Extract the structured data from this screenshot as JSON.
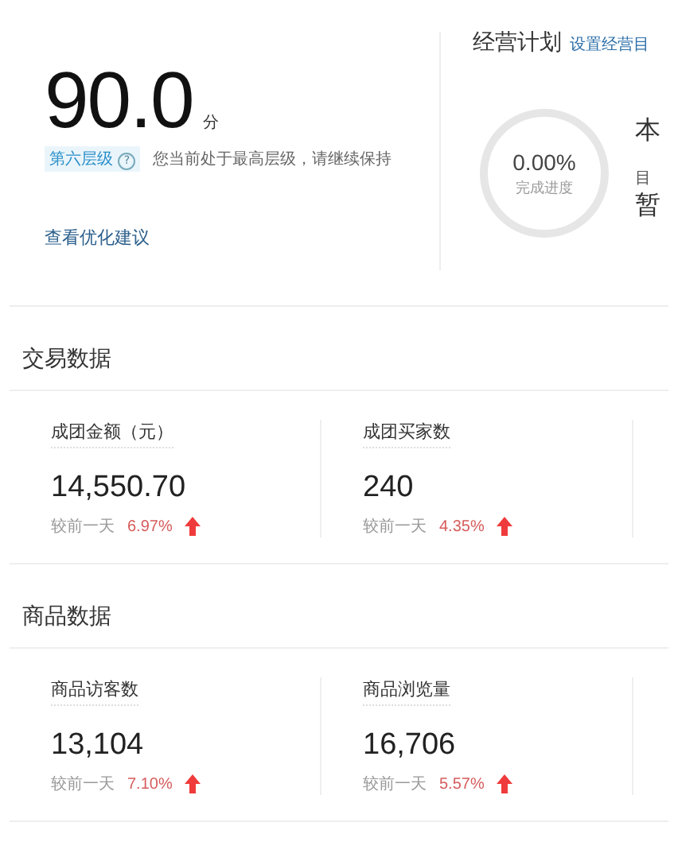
{
  "score": {
    "value": "90.0",
    "unit": "分",
    "level_tag": "第六层级",
    "level_help": "?",
    "message": "您当前处于最高层级，请继续保持",
    "link": "查看优化建议"
  },
  "plan": {
    "title": "经营计划",
    "link": "设置经营目",
    "progress_value": "0.00%",
    "progress_label": "完成进度",
    "month_label": "本",
    "target_label": "目",
    "target_value": "暂"
  },
  "sections": [
    {
      "title": "交易数据",
      "metrics": [
        {
          "label": "成团金额（元）",
          "value": "14,550.70",
          "compare": "较前一天",
          "change": "6.97%",
          "kind": "up"
        },
        {
          "label": "成团买家数",
          "value": "240",
          "compare": "较前一天",
          "change": "4.35%",
          "kind": "up"
        }
      ]
    },
    {
      "title": "商品数据",
      "metrics": [
        {
          "label": "商品访客数",
          "value": "13,104",
          "compare": "较前一天",
          "change": "7.10%",
          "kind": "up"
        },
        {
          "label": "商品浏览量",
          "value": "16,706",
          "compare": "较前一天",
          "change": "5.57%",
          "kind": "up"
        }
      ]
    }
  ]
}
